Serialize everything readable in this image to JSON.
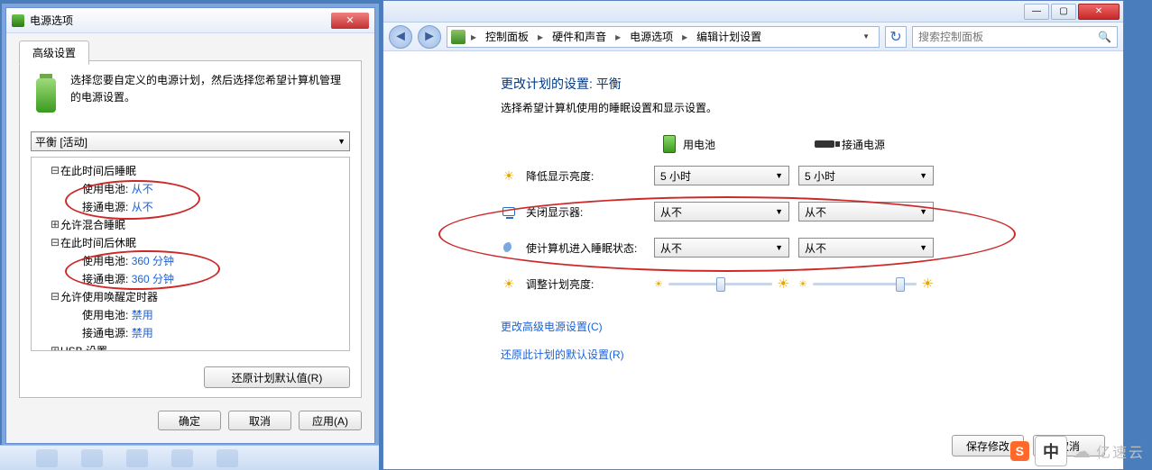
{
  "left_dialog": {
    "title": "电源选项",
    "tab": "高级设置",
    "description": "选择您要自定义的电源计划，然后选择您希望计算机管理的电源设置。",
    "plan_selected": "平衡 [活动]",
    "tree": {
      "sleep_after": {
        "label": "在此时间后睡眠",
        "battery_label": "使用电池:",
        "battery_value": "从不",
        "plugged_label": "接通电源:",
        "plugged_value": "从不"
      },
      "hybrid_sleep": {
        "label": "允许混合睡眠"
      },
      "hibernate_after": {
        "label": "在此时间后休眠",
        "battery_label": "使用电池:",
        "battery_value": "360 分钟",
        "plugged_label": "接通电源:",
        "plugged_value": "360 分钟"
      },
      "wake_timers": {
        "label": "允许使用唤醒定时器",
        "battery_label": "使用电池:",
        "battery_value": "禁用",
        "plugged_label": "接通电源:",
        "plugged_value": "禁用"
      },
      "usb": {
        "label": "USB 设置"
      }
    },
    "restore_defaults": "还原计划默认值(R)",
    "ok": "确定",
    "cancel": "取消",
    "apply": "应用(A)"
  },
  "right_window": {
    "breadcrumb": {
      "cp": "控制面板",
      "hw": "硬件和声音",
      "pw": "电源选项",
      "edit": "编辑计划设置"
    },
    "search_placeholder": "搜索控制面板",
    "title": "更改计划的设置: 平衡",
    "subtitle": "选择希望计算机使用的睡眠设置和显示设置。",
    "col_battery": "用电池",
    "col_plugged": "接通电源",
    "rows": {
      "dim": {
        "label": "降低显示亮度:",
        "battery": "5 小时",
        "plugged": "5 小时"
      },
      "off": {
        "label": "关闭显示器:",
        "battery": "从不",
        "plugged": "从不"
      },
      "sleep": {
        "label": "使计算机进入睡眠状态:",
        "battery": "从不",
        "plugged": "从不"
      },
      "bright": {
        "label": "调整计划亮度:"
      }
    },
    "link_adv": "更改高级电源设置(C)",
    "link_restore": "还原此计划的默认设置(R)",
    "save": "保存修改",
    "cancel": "取消"
  },
  "logos": {
    "s": "S",
    "zh": "中",
    "ysy": "亿速云"
  }
}
